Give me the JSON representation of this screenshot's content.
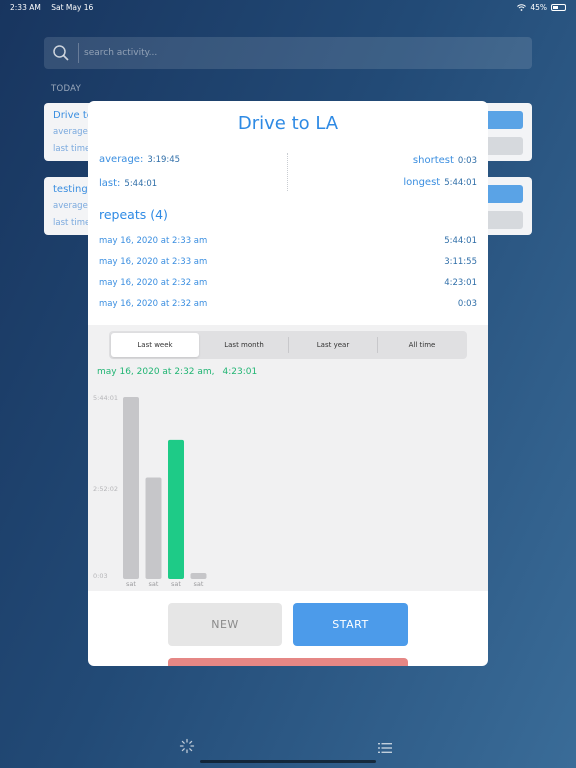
{
  "status_bar": {
    "time": "2:33 AM",
    "date": "Sat May 16",
    "battery": "45%"
  },
  "search": {
    "placeholder": "search activity..."
  },
  "section": {
    "label": "TODAY"
  },
  "background_cards": [
    {
      "title": "Drive to LA",
      "line1": "average",
      "line2": "last time"
    },
    {
      "title": "testing",
      "line1": "average",
      "line2": "last time"
    }
  ],
  "modal": {
    "title": "Drive to LA",
    "stats": {
      "average_label": "average:",
      "average_value": "3:19:45",
      "last_label": "last:",
      "last_value": "5:44:01",
      "shortest_label": "shortest",
      "shortest_value": "0:03",
      "longest_label": "longest",
      "longest_value": "5:44:01"
    },
    "repeats_title": "repeats (4)",
    "repeats": [
      {
        "date": "may 16, 2020 at 2:33 am",
        "value": "5:44:01"
      },
      {
        "date": "may 16, 2020 at 2:33 am",
        "value": "3:11:55"
      },
      {
        "date": "may 16, 2020 at 2:32 am",
        "value": "4:23:01"
      },
      {
        "date": "may 16, 2020 at 2:32 am",
        "value": "0:03"
      }
    ],
    "tabs": [
      {
        "label": "Last week",
        "active": true
      },
      {
        "label": "Last month",
        "active": false
      },
      {
        "label": "Last year",
        "active": false
      },
      {
        "label": "All time",
        "active": false
      }
    ],
    "selected_point": {
      "date": "may 16, 2020 at 2:32 am,",
      "value": "4:23:01"
    },
    "new_label": "NEW",
    "start_label": "START"
  },
  "chart_data": {
    "type": "bar",
    "categories": [
      "sat",
      "sat",
      "sat",
      "sat"
    ],
    "values": [
      20641,
      11515,
      15781,
      3
    ],
    "highlight_index": 2,
    "y_ticks": [
      {
        "value": 20641,
        "label": "5:44:01"
      },
      {
        "value": 10322,
        "label": "2:52:02"
      },
      {
        "value": 3,
        "label": "0:03"
      }
    ],
    "ylim": [
      0,
      20641
    ],
    "colors": {
      "bar": "#c6c6c9",
      "highlight": "#1ecb87"
    }
  }
}
